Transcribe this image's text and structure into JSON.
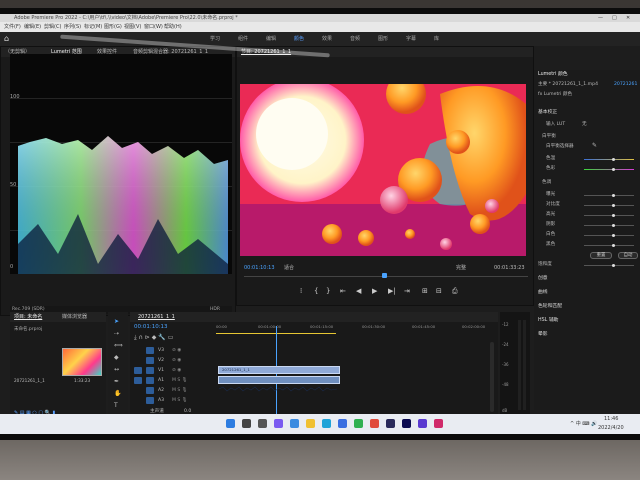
{
  "app": {
    "title": "Adobe Premiere Pro 2022 - C:\\用户\\tf\\.\\\\video\\文档\\Adobe\\Premiere Pro\\22.0\\未命名.prproj *",
    "window_controls": [
      "—",
      "□",
      "✕"
    ]
  },
  "menu": [
    "文件(F)",
    "编辑(E)",
    "剪辑(C)",
    "序列(S)",
    "标记(M)",
    "图形(G)",
    "视图(V)",
    "窗口(W)",
    "帮助(H)"
  ],
  "workspaces": [
    {
      "label": "学习",
      "active": false
    },
    {
      "label": "组件",
      "active": false
    },
    {
      "label": "编辑",
      "active": false
    },
    {
      "label": "颜色",
      "active": true
    },
    {
      "label": "效果",
      "active": false
    },
    {
      "label": "音频",
      "active": false
    },
    {
      "label": "图形",
      "active": false
    },
    {
      "label": "字幕",
      "active": false
    },
    {
      "label": "库",
      "active": false
    }
  ],
  "left_panel": {
    "tabs": [
      "（无剪辑）",
      "Lumetri 范围",
      "效果控件",
      "音频剪辑混合器: 20721261_1_1"
    ],
    "active_tab": "Lumetri 范围",
    "scale_labels": [
      "100",
      "50",
      "0"
    ],
    "footer_left": "Rec.709 (SDR)",
    "footer_right": "HDR"
  },
  "program_monitor": {
    "tab": "节目: 20721261_1_1",
    "timecode_in": "00:01:10:13",
    "fit": "适合",
    "quality": "完整",
    "timecode_out": "00:01:33:23",
    "controls": [
      "⁞",
      "{",
      "}",
      "⇤",
      "◀",
      "▶",
      "▶|",
      "⇥",
      "⊞",
      "⊟",
      "⎙"
    ]
  },
  "lumetri_panel": {
    "title": "Lumetri 颜色",
    "clip": "主要 * 20721261_1_1.mp4",
    "seq": "20721261",
    "effect": "fx Lumetri 颜色",
    "sections": [
      {
        "label": "基本校正"
      },
      {
        "label": "输入 LUT",
        "value": "无"
      },
      {
        "label": "白平衡"
      },
      {
        "label": "白平衡选择器"
      },
      {
        "label": "色温"
      },
      {
        "label": "色彩"
      },
      {
        "label": "色调"
      },
      {
        "label": "曝光"
      },
      {
        "label": "对比度"
      },
      {
        "label": "高光"
      },
      {
        "label": "阴影"
      },
      {
        "label": "白色"
      },
      {
        "label": "黑色"
      },
      {
        "label": "重置"
      },
      {
        "label": "自动"
      },
      {
        "label": "饱和度"
      },
      {
        "label": "创意"
      },
      {
        "label": "曲线"
      },
      {
        "label": "色轮和匹配"
      },
      {
        "label": "HSL 辅助"
      },
      {
        "label": "晕影"
      }
    ]
  },
  "project_panel": {
    "tabs": [
      "项目: 未命名",
      "媒体浏览器"
    ],
    "file": "未命名.prproj",
    "clip_name": "20721261_1_1",
    "clip_duration": "1:33:23"
  },
  "timeline": {
    "tab": "20721261_1_1",
    "timecode": "00:01:10:13",
    "ruler": [
      "00:00",
      "00:01:00:00",
      "00:01:15:00",
      "00:01:30:00",
      "00:01:45:00",
      "00:02:00:00"
    ],
    "tracks": [
      "V3",
      "V2",
      "V1",
      "A1",
      "A2",
      "A3",
      "主声道"
    ],
    "master_value": "0.0"
  },
  "meter": {
    "labels": [
      "-12",
      "-24",
      "-36",
      "-48",
      "dB"
    ]
  },
  "taskbar": {
    "time": "11:46",
    "date": "2022/4/20"
  },
  "colors": {
    "accent": "#2d8cff",
    "timeline_bg": "#191919",
    "panel_bg": "#1a1a1a"
  }
}
